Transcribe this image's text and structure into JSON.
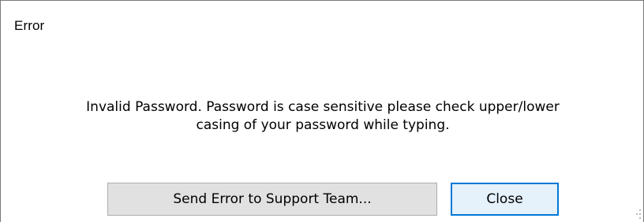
{
  "dialog": {
    "title": "Error",
    "message_line1": "Invalid Password. Password is case sensitive please check upper/lower",
    "message_line2": "casing of your password while typing."
  },
  "buttons": {
    "send_label": "Send Error to Support Team...",
    "close_label": "Close"
  },
  "colors": {
    "focus_border": "#0078d7",
    "button_face": "#e1e1e1",
    "window_border": "#7a7a7a"
  },
  "icons": {
    "resize_grip": "size-grip-icon"
  }
}
